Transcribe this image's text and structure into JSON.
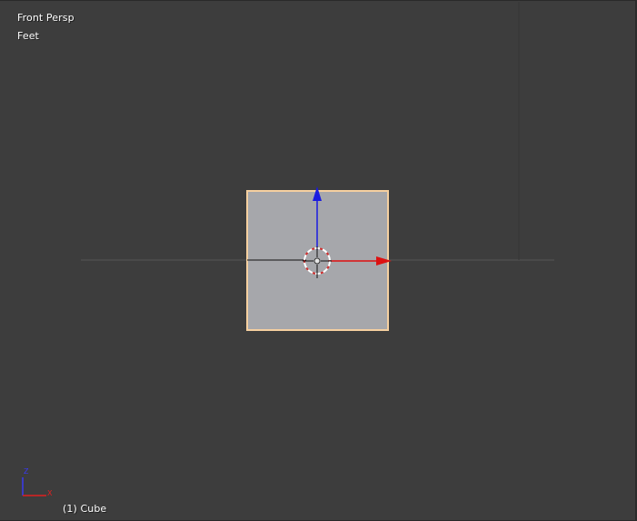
{
  "viewport": {
    "view_name": "Front Persp",
    "units": "Feet",
    "active_object": "(1) Cube"
  },
  "scene": {
    "selected_object": "Cube",
    "selection_outline_color": "#f5d0a0",
    "object_face_color": "#a6a7ab"
  },
  "manipulator": {
    "x_axis_color": "#dd1111",
    "z_axis_color": "#1a1ae0"
  },
  "navigation_axes": {
    "z_label": "Z",
    "x_label": "X",
    "z_color": "#3a3af0",
    "x_color": "#e02020"
  },
  "colors": {
    "viewport_background": "#3d3d3d",
    "overlay_text": "#ffffff"
  }
}
